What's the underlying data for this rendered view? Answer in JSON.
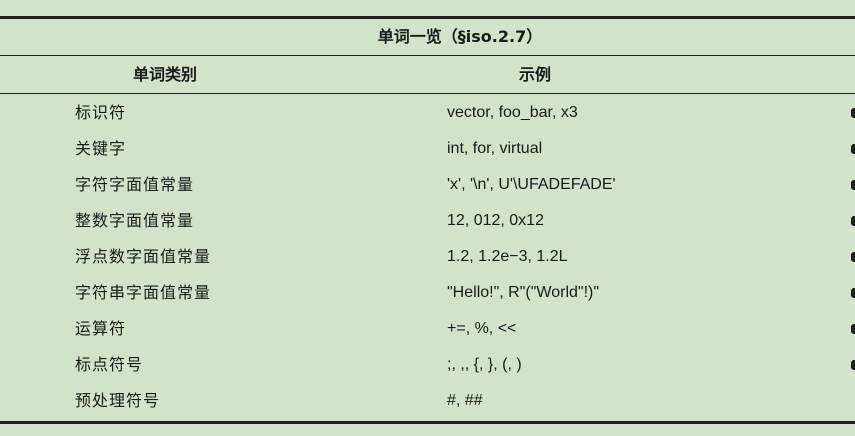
{
  "table": {
    "caption": "单词一览（§iso.2.7）",
    "headers": {
      "category": "单词类别",
      "example": "示例"
    },
    "rows": [
      {
        "category": "标识符",
        "example": "vector, foo_bar, x3"
      },
      {
        "category": "关键字",
        "example": "int, for, virtual"
      },
      {
        "category": "字符字面值常量",
        "example": "'x', '\\n', U'\\UFADEFADE'"
      },
      {
        "category": "整数字面值常量",
        "example": "12, 012, 0x12"
      },
      {
        "category": "浮点数字面值常量",
        "example": "1.2, 1.2e−3, 1.2L"
      },
      {
        "category": "字符串字面值常量",
        "example": "\"Hello!\", R\"(\"World\"!)\""
      },
      {
        "category": "运算符",
        "example": "+=, %, <<"
      },
      {
        "category": "标点符号",
        "example": ";, ,, {, }, (, )"
      },
      {
        "category": "预处理符号",
        "example": "#, ##"
      }
    ]
  }
}
